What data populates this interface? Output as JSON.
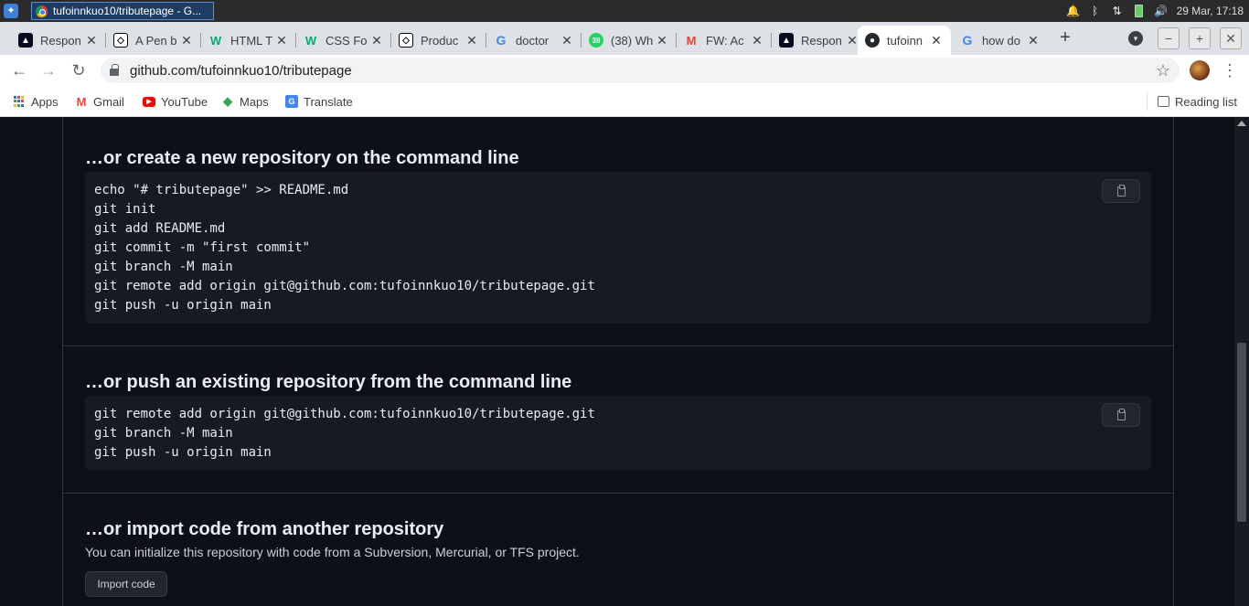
{
  "taskbar": {
    "window_title": "tufoinnkuo10/tributepage - G...",
    "datetime": "29 Mar, 17:18"
  },
  "tabs": [
    {
      "label": "Respon",
      "favicon": "freecodecamp-icon",
      "active": false
    },
    {
      "label": "A Pen b",
      "favicon": "codepen-icon",
      "active": false
    },
    {
      "label": "HTML T",
      "favicon": "w3schools-icon",
      "active": false
    },
    {
      "label": "CSS Fo",
      "favicon": "w3schools-icon",
      "active": false
    },
    {
      "label": "Produc",
      "favicon": "codepen-icon",
      "active": false
    },
    {
      "label": "doctor",
      "favicon": "google-icon",
      "active": false
    },
    {
      "label": "(38) Wh",
      "favicon": "whatsapp-icon",
      "active": false
    },
    {
      "label": "FW: Ac",
      "favicon": "gmail-icon",
      "active": false
    },
    {
      "label": "Respon",
      "favicon": "freecodecamp-icon",
      "active": false
    },
    {
      "label": "tufoinn",
      "favicon": "github-icon",
      "active": true
    },
    {
      "label": "how do",
      "favicon": "google-icon",
      "active": false
    }
  ],
  "address_bar": {
    "url": "github.com/tufoinnkuo10/tributepage"
  },
  "bookmarks": [
    {
      "label": "Apps",
      "icon": "apps-grid-icon"
    },
    {
      "label": "Gmail",
      "icon": "gmail-icon"
    },
    {
      "label": "YouTube",
      "icon": "youtube-icon"
    },
    {
      "label": "Maps",
      "icon": "maps-icon"
    },
    {
      "label": "Translate",
      "icon": "translate-icon"
    }
  ],
  "reading_list_label": "Reading list",
  "sections": {
    "create": {
      "title": "…or create a new repository on the command line",
      "lines": [
        "echo \"# tributepage\" >> README.md",
        "git init",
        "git add README.md",
        "git commit -m \"first commit\"",
        "git branch -M main",
        "git remote add origin git@github.com:tufoinnkuo10/tributepage.git",
        "git push -u origin main"
      ]
    },
    "push": {
      "title": "…or push an existing repository from the command line",
      "lines": [
        "git remote add origin git@github.com:tufoinnkuo10/tributepage.git",
        "git branch -M main",
        "git push -u origin main"
      ]
    },
    "import": {
      "title": "…or import code from another repository",
      "description": "You can initialize this repository with code from a Subversion, Mercurial, or TFS project.",
      "button_label": "Import code"
    }
  },
  "colors": {
    "page_bg": "#0d1117",
    "code_bg": "#161b22",
    "border": "#30363d",
    "text": "#e6edf3"
  }
}
